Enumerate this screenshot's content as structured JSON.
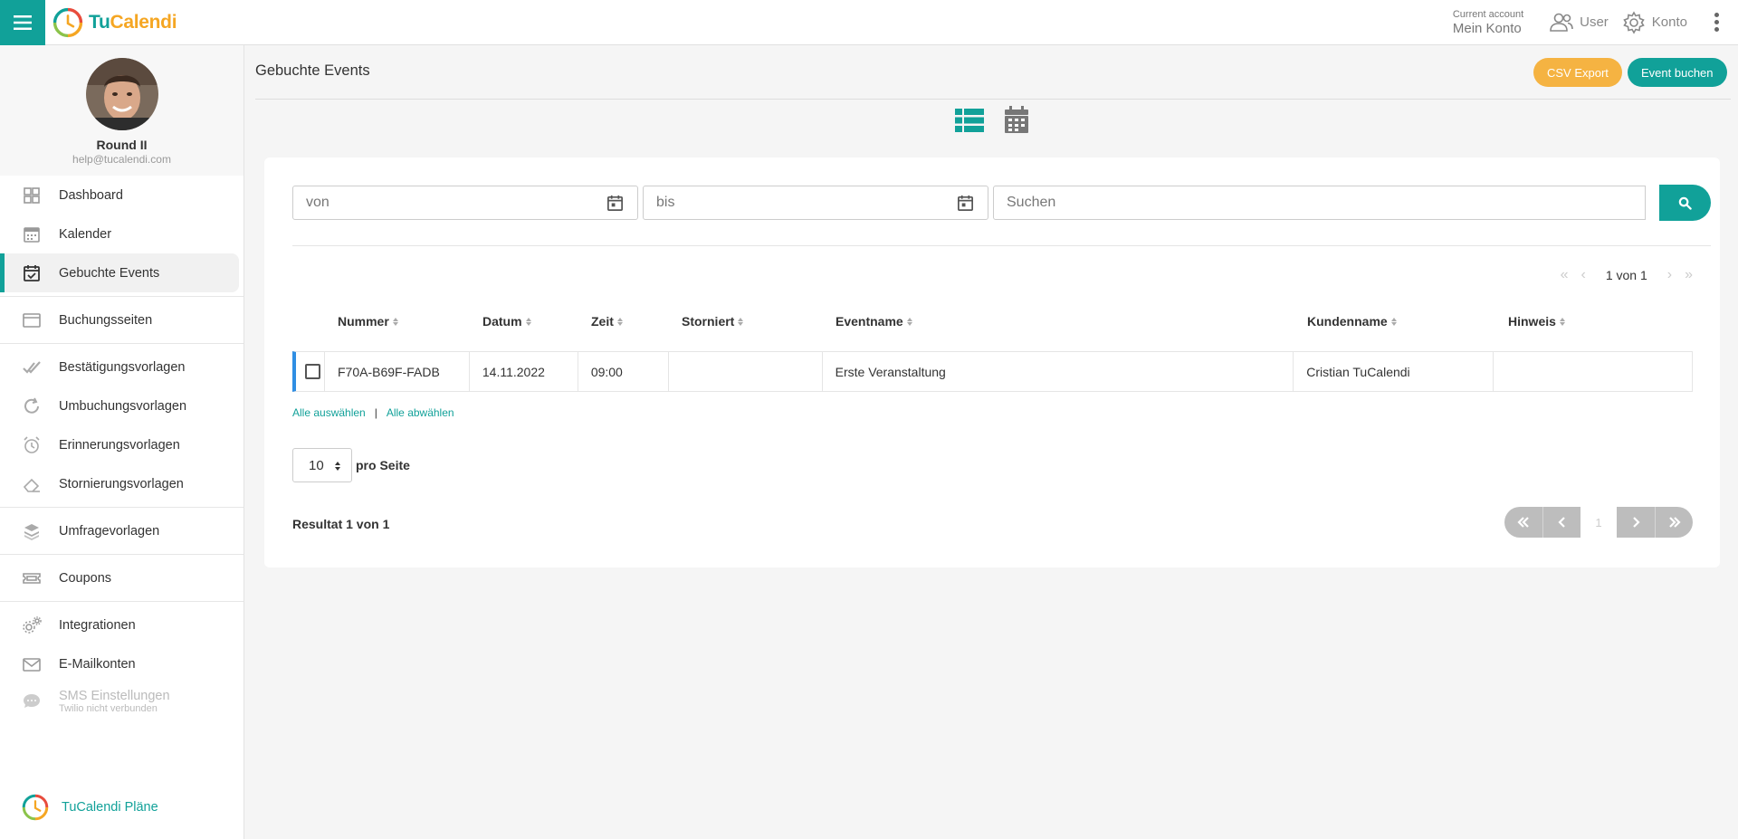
{
  "app": {
    "brand_tu": "Tu",
    "brand_cal": "Calendi"
  },
  "topbar": {
    "account_small": "Current account",
    "account_big": "Mein Konto",
    "user_label": "User",
    "konto_label": "Konto"
  },
  "profile": {
    "name": "Round II",
    "email": "help@tucalendi.com"
  },
  "sidebar": {
    "items": [
      {
        "label": "Dashboard"
      },
      {
        "label": "Kalender"
      },
      {
        "label": "Gebuchte Events"
      },
      {
        "label": "Buchungsseiten"
      },
      {
        "label": "Bestätigungsvorlagen"
      },
      {
        "label": "Umbuchungsvorlagen"
      },
      {
        "label": "Erinnerungsvorlagen"
      },
      {
        "label": "Stornierungsvorlagen"
      },
      {
        "label": "Umfragevorlagen"
      },
      {
        "label": "Coupons"
      },
      {
        "label": "Integrationen"
      },
      {
        "label": "E-Mailkonten"
      },
      {
        "label": "SMS Einstellungen",
        "sub": "Twilio nicht verbunden"
      }
    ],
    "plans_label": "TuCalendi Pläne"
  },
  "main": {
    "title": "Gebuchte Events",
    "csv_label": "CSV Export",
    "book_label": "Event buchen",
    "filters": {
      "von": "von",
      "bis": "bis",
      "search": "Suchen"
    },
    "pager_top": "1 von 1",
    "columns": [
      "Nummer",
      "Datum",
      "Zeit",
      "Storniert",
      "Eventname",
      "Kundenname",
      "Hinweis"
    ],
    "rows": [
      {
        "nummer": "F70A-B69F-FADB",
        "datum": "14.11.2022",
        "zeit": "09:00",
        "storniert": "",
        "eventname": "Erste Veranstaltung",
        "kundenname": "Cristian TuCalendi",
        "hinweis": ""
      }
    ],
    "select_all": "Alle auswählen",
    "separator": "|",
    "deselect_all": "Alle abwählen",
    "per_page_value": "10",
    "per_page_label": "pro Seite",
    "result": "Resultat 1 von 1",
    "pager_bottom_page": "1"
  },
  "colors": {
    "accent": "#11a199",
    "orange": "#f5b342",
    "row_marker": "#2f8ee3"
  }
}
